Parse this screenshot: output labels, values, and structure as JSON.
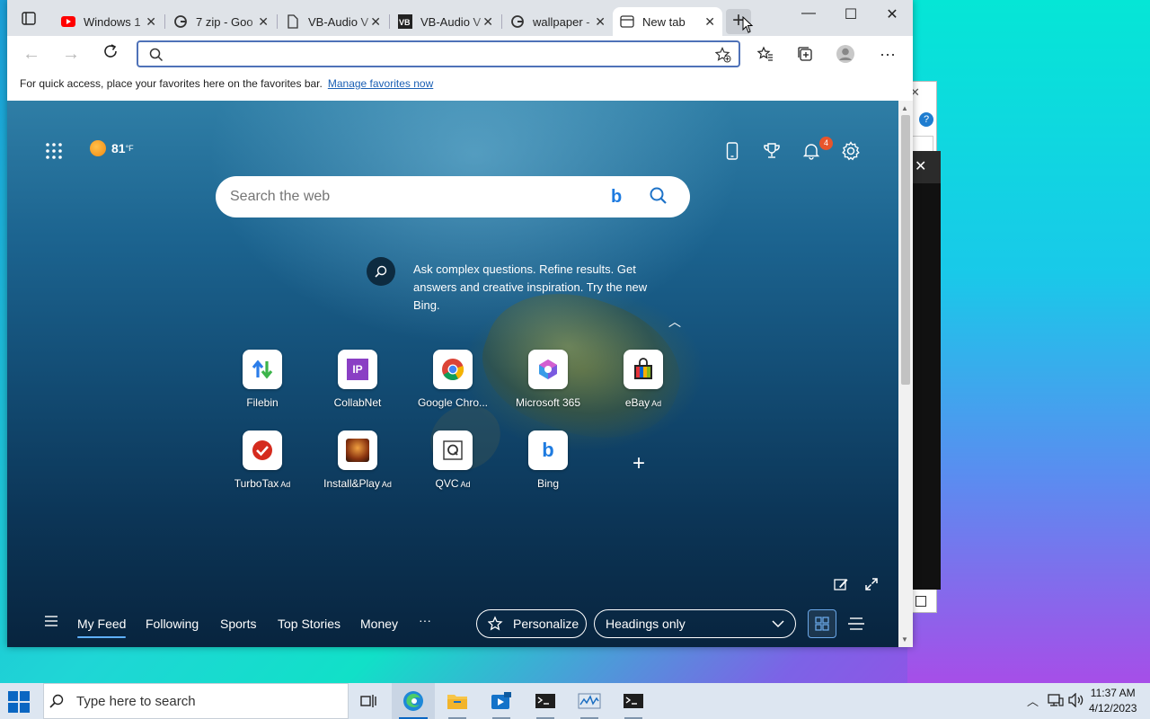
{
  "browser": {
    "tabs": [
      {
        "title": "Windows 1",
        "icon": "youtube-icon"
      },
      {
        "title": "7 zip - Goo",
        "icon": "google-icon"
      },
      {
        "title": "VB-Audio V",
        "icon": "page-icon"
      },
      {
        "title": "VB-Audio V",
        "icon": "vb-icon"
      },
      {
        "title": "wallpaper -",
        "icon": "google-icon"
      },
      {
        "title": "New tab",
        "icon": "newtab-icon",
        "active": true
      }
    ],
    "address": {
      "value": "",
      "placeholder": ""
    },
    "favbar": {
      "text": "For quick access, place your favorites here on the favorites bar.",
      "link": "Manage favorites now"
    }
  },
  "ntp": {
    "weather": {
      "temp": "81",
      "unit": "°F"
    },
    "notifications_count": "4",
    "search_placeholder": "Search the web",
    "bing_promo": "Ask complex questions. Refine results. Get answers and creative inspiration. Try the new Bing.",
    "tiles": [
      {
        "label": "Filebin",
        "ad": ""
      },
      {
        "label": "CollabNet",
        "ad": ""
      },
      {
        "label": "Google Chro...",
        "ad": ""
      },
      {
        "label": "Microsoft 365",
        "ad": ""
      },
      {
        "label": "eBay",
        "ad": "Ad"
      },
      {
        "label": "TurboTax",
        "ad": "Ad"
      },
      {
        "label": "Install&Play",
        "ad": "Ad"
      },
      {
        "label": "QVC",
        "ad": "Ad"
      },
      {
        "label": "Bing",
        "ad": ""
      }
    ],
    "feed": {
      "items": [
        "My Feed",
        "Following",
        "Sports",
        "Top Stories",
        "Money"
      ],
      "more": "···",
      "personalize": "Personalize",
      "layout_select": "Headings only"
    }
  },
  "taskbar": {
    "search_placeholder": "Type here to search",
    "time": "11:37 AM",
    "date": "4/12/2023"
  },
  "colors": {
    "accent": "#0a66c2",
    "tabbar": "#dfe3e8",
    "ntp_top": "#2f7ea6",
    "ntp_bottom": "#08243e"
  }
}
